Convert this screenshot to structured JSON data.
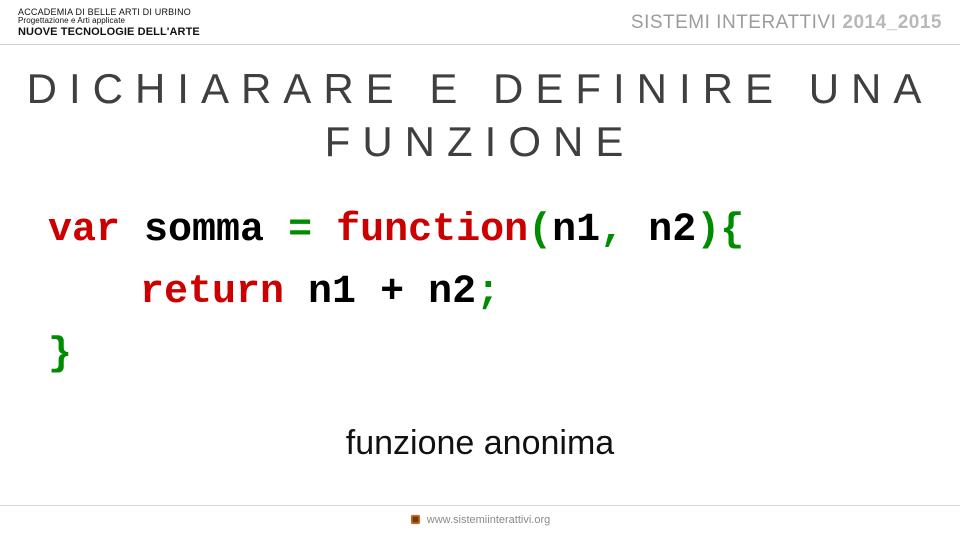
{
  "header": {
    "left": {
      "line1": "ACCADEMIA DI BELLE ARTI DI URBINO",
      "line2": "Progettazione e Arti applicate",
      "line3": "NUOVE TECNOLOGIE DELL'ARTE"
    },
    "right": {
      "title": "SISTEMI INTERATTIVI",
      "year": "2014_2015"
    }
  },
  "title": "DICHIARARE E DEFINIRE UNA FUNZIONE",
  "code": {
    "tokens": {
      "var": "var",
      "sp1": " ",
      "somma": "somma",
      "sp2": " ",
      "eq": "=",
      "sp3": " ",
      "function": "function",
      "lparen": "(",
      "n1a": "n1",
      "comma": ",",
      "sp4": " ",
      "n2a": "n2",
      "rparen": ")",
      "lbrace": "{",
      "return": "return",
      "sp5": " ",
      "n1b": "n1",
      "sp6": " ",
      "plus": "+",
      "sp7": " ",
      "n2b": "n2",
      "semi": ";",
      "rbrace": "}"
    }
  },
  "caption": "funzione anonima",
  "footer": {
    "url": "www.sistemiinterattivi.org"
  }
}
